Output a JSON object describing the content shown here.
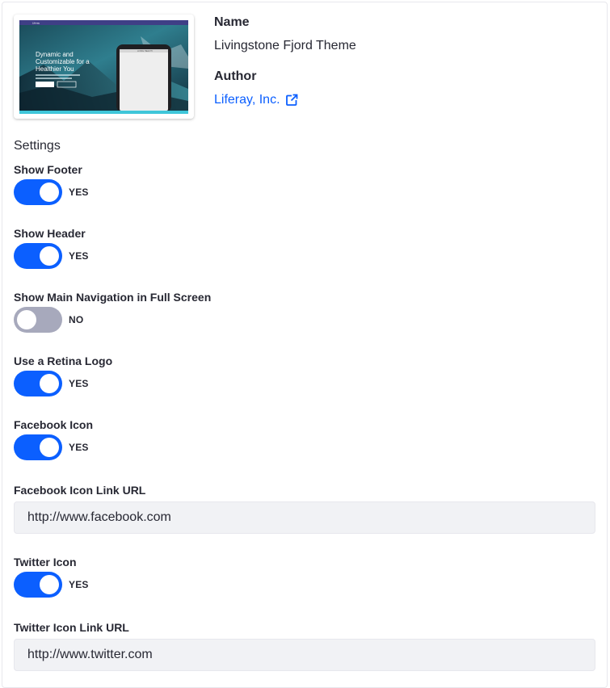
{
  "theme": {
    "name_label": "Name",
    "name_value": "Livingstone Fjord Theme",
    "author_label": "Author",
    "author_value": "Liferay, Inc.",
    "link_color": "#0b5fff",
    "preview": {
      "brand": "Liferay",
      "headline_line1": "Dynamic and",
      "headline_line2": "Customizable for a",
      "headline_line3": "Healthier You",
      "phone_header": "LIVING HEALTH"
    }
  },
  "settings": {
    "title": "Settings",
    "accent_color": "#0b5fff",
    "off_color": "#a7a9bc",
    "items": [
      {
        "label": "Show Footer",
        "state": "YES"
      },
      {
        "label": "Show Header",
        "state": "YES"
      },
      {
        "label": "Show Main Navigation in Full Screen",
        "state": "NO"
      },
      {
        "label": "Use a Retina Logo",
        "state": "YES"
      },
      {
        "label": "Facebook Icon",
        "state": "YES"
      },
      {
        "label": "Twitter Icon",
        "state": "YES"
      }
    ],
    "facebook_url_label": "Facebook Icon Link URL",
    "facebook_url_value": "http://www.facebook.com",
    "twitter_url_label": "Twitter Icon Link URL",
    "twitter_url_value": "http://www.twitter.com"
  }
}
